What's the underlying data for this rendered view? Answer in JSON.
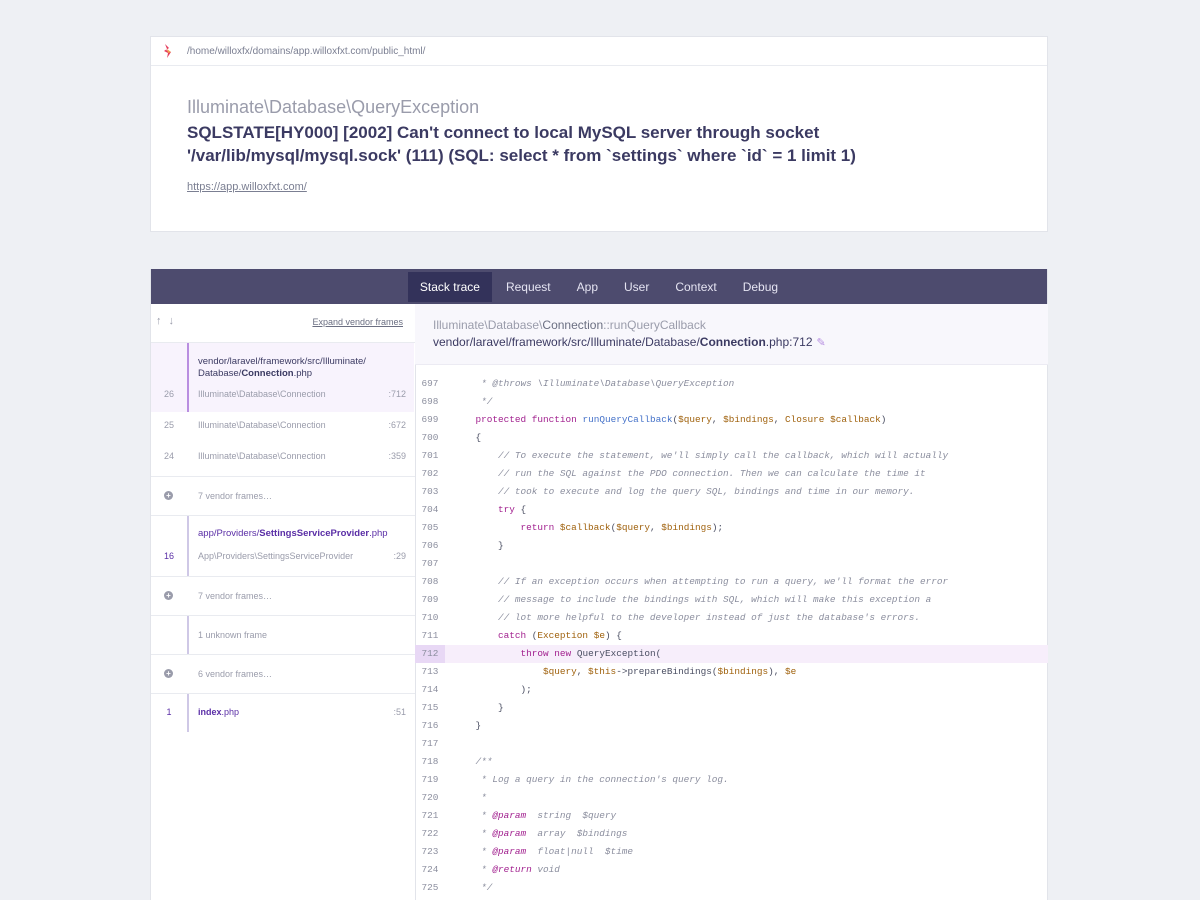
{
  "header": {
    "path": "/home/willoxfx/domains/app.willoxfxt.com/public_html/",
    "exception_class": "Illuminate\\Database\\QueryException",
    "exception_message": "SQLSTATE[HY000] [2002] Can't connect to local MySQL server through socket '/var/lib/mysql/mysql.sock' (111) (SQL: select * from `settings` where `id` = 1 limit 1)",
    "url": "https://app.willoxfxt.com/"
  },
  "tabs": [
    "Stack trace",
    "Request",
    "App",
    "User",
    "Context",
    "Debug"
  ],
  "active_tab": "Stack trace",
  "frames": {
    "expand_label": "Expand vendor frames",
    "group1": {
      "file_prefix": "vendor/laravel/framework/src/Illuminate/",
      "file_prefix2": "Database/",
      "file_bold": "Connection",
      "file_ext": ".php",
      "rows": [
        {
          "num": "26",
          "cls": "Illuminate\\Database\\Connection",
          "line": ":712"
        },
        {
          "num": "25",
          "cls": "Illuminate\\Database\\Connection",
          "line": ":672"
        },
        {
          "num": "24",
          "cls": "Illuminate\\Database\\Connection",
          "line": ":359"
        }
      ]
    },
    "vendor1": "7 vendor frames…",
    "group2": {
      "file_prefix": "app/Providers/",
      "file_bold": "SettingsServiceProvider",
      "file_ext": ".php",
      "num": "16",
      "cls_prefix": "App\\Providers\\",
      "cls_name": "SettingsServiceProvider",
      "line": ":29"
    },
    "vendor2": "7 vendor frames…",
    "unknown": "1 unknown frame",
    "vendor3": "6 vendor frames…",
    "group3": {
      "num": "1",
      "file_bold": "index",
      "file_ext": ".php",
      "line": ":51"
    }
  },
  "code_header": {
    "class_prefix": "Illuminate\\Database\\",
    "class_name": "Connection",
    "method": "::runQueryCallback",
    "file_prefix": "vendor/laravel/framework/src/Illuminate/Database/",
    "file_bold": "Connection",
    "file_suffix": ".php:712"
  },
  "code": {
    "highlight_line": "712",
    "lines": [
      {
        "n": "697",
        "t": "     * @throws \\Illuminate\\Database\\QueryException"
      },
      {
        "n": "698",
        "t": "     */"
      },
      {
        "n": "699",
        "t": "    protected function runQueryCallback($query, $bindings, Closure $callback)"
      },
      {
        "n": "700",
        "t": "    {"
      },
      {
        "n": "701",
        "t": "        // To execute the statement, we'll simply call the callback, which will actually"
      },
      {
        "n": "702",
        "t": "        // run the SQL against the PDO connection. Then we can calculate the time it"
      },
      {
        "n": "703",
        "t": "        // took to execute and log the query SQL, bindings and time in our memory."
      },
      {
        "n": "704",
        "t": "        try {"
      },
      {
        "n": "705",
        "t": "            return $callback($query, $bindings);"
      },
      {
        "n": "706",
        "t": "        }"
      },
      {
        "n": "707",
        "t": ""
      },
      {
        "n": "708",
        "t": "        // If an exception occurs when attempting to run a query, we'll format the error"
      },
      {
        "n": "709",
        "t": "        // message to include the bindings with SQL, which will make this exception a"
      },
      {
        "n": "710",
        "t": "        // lot more helpful to the developer instead of just the database's errors."
      },
      {
        "n": "711",
        "t": "        catch (Exception $e) {"
      },
      {
        "n": "712",
        "t": "            throw new QueryException("
      },
      {
        "n": "713",
        "t": "                $query, $this->prepareBindings($bindings), $e"
      },
      {
        "n": "714",
        "t": "            );"
      },
      {
        "n": "715",
        "t": "        }"
      },
      {
        "n": "716",
        "t": "    }"
      },
      {
        "n": "717",
        "t": ""
      },
      {
        "n": "718",
        "t": "    /**"
      },
      {
        "n": "719",
        "t": "     * Log a query in the connection's query log."
      },
      {
        "n": "720",
        "t": "     *"
      },
      {
        "n": "721",
        "t": "     * @param  string  $query"
      },
      {
        "n": "722",
        "t": "     * @param  array  $bindings"
      },
      {
        "n": "723",
        "t": "     * @param  float|null  $time"
      },
      {
        "n": "724",
        "t": "     * @return void"
      },
      {
        "n": "725",
        "t": "     */"
      }
    ]
  }
}
